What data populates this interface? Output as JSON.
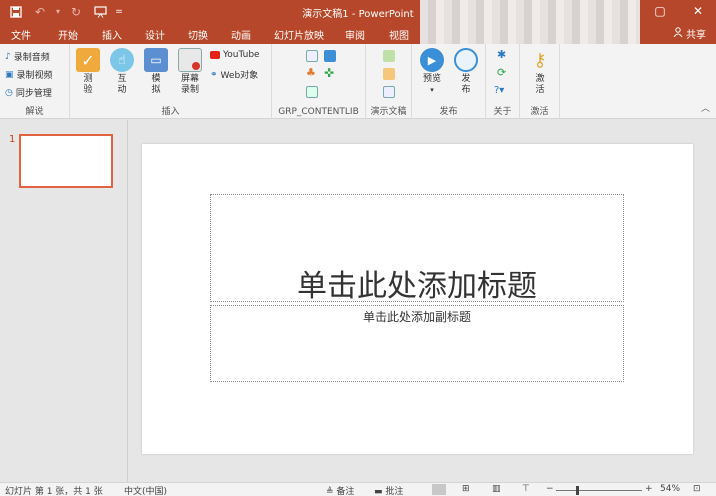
{
  "titlebar": {
    "title": "演示文稿1 - PowerPoint",
    "qat": {
      "save_icon": "save-icon",
      "undo_icon": "undo-icon",
      "redo_icon": "redo-icon",
      "present_icon": "start-presentation-icon",
      "customize_icon": "customize-icon"
    },
    "window": {
      "restore": "▢",
      "close": "✕"
    }
  },
  "tabs": [
    "文件",
    "开始",
    "插入",
    "设计",
    "切换",
    "动画",
    "幻灯片放映",
    "审阅",
    "视图"
  ],
  "share": "共享",
  "ribbon": {
    "groups": {
      "explain": {
        "label": "解说",
        "items": [
          "录制音频",
          "录制视频",
          "同步管理"
        ]
      },
      "insert": {
        "label": "插入",
        "big": [
          {
            "lines": [
              "测",
              "验"
            ]
          },
          {
            "lines": [
              "互",
              "动"
            ]
          },
          {
            "lines": [
              "模",
              "拟"
            ]
          },
          {
            "lines": [
              "屏幕",
              "录制"
            ]
          }
        ],
        "small": [
          "YouTube",
          "Web对象"
        ]
      },
      "grp": {
        "label": "GRP_CONTENTLIB"
      },
      "demo": {
        "label": "演示文稿"
      },
      "publish": {
        "label": "发布",
        "big": [
          {
            "lines": [
              "预览"
            ]
          },
          {
            "lines": [
              "发",
              "布"
            ]
          }
        ]
      },
      "about": {
        "label": "关于"
      },
      "activate": {
        "label": "激活",
        "big": [
          {
            "lines": [
              "激",
              "活"
            ]
          }
        ]
      }
    }
  },
  "thumbs": {
    "slide_number": "1"
  },
  "slide": {
    "title_placeholder": "单击此处添加标题",
    "subtitle_placeholder": "单击此处添加副标题"
  },
  "status": {
    "slide_info": "幻灯片 第 1 张，共 1 张",
    "language": "中文(中国)",
    "notes": "备注",
    "comments": "批注",
    "zoom": "54%"
  },
  "colors": {
    "accent": "#b7472a",
    "thumb_border": "#e2633f"
  }
}
